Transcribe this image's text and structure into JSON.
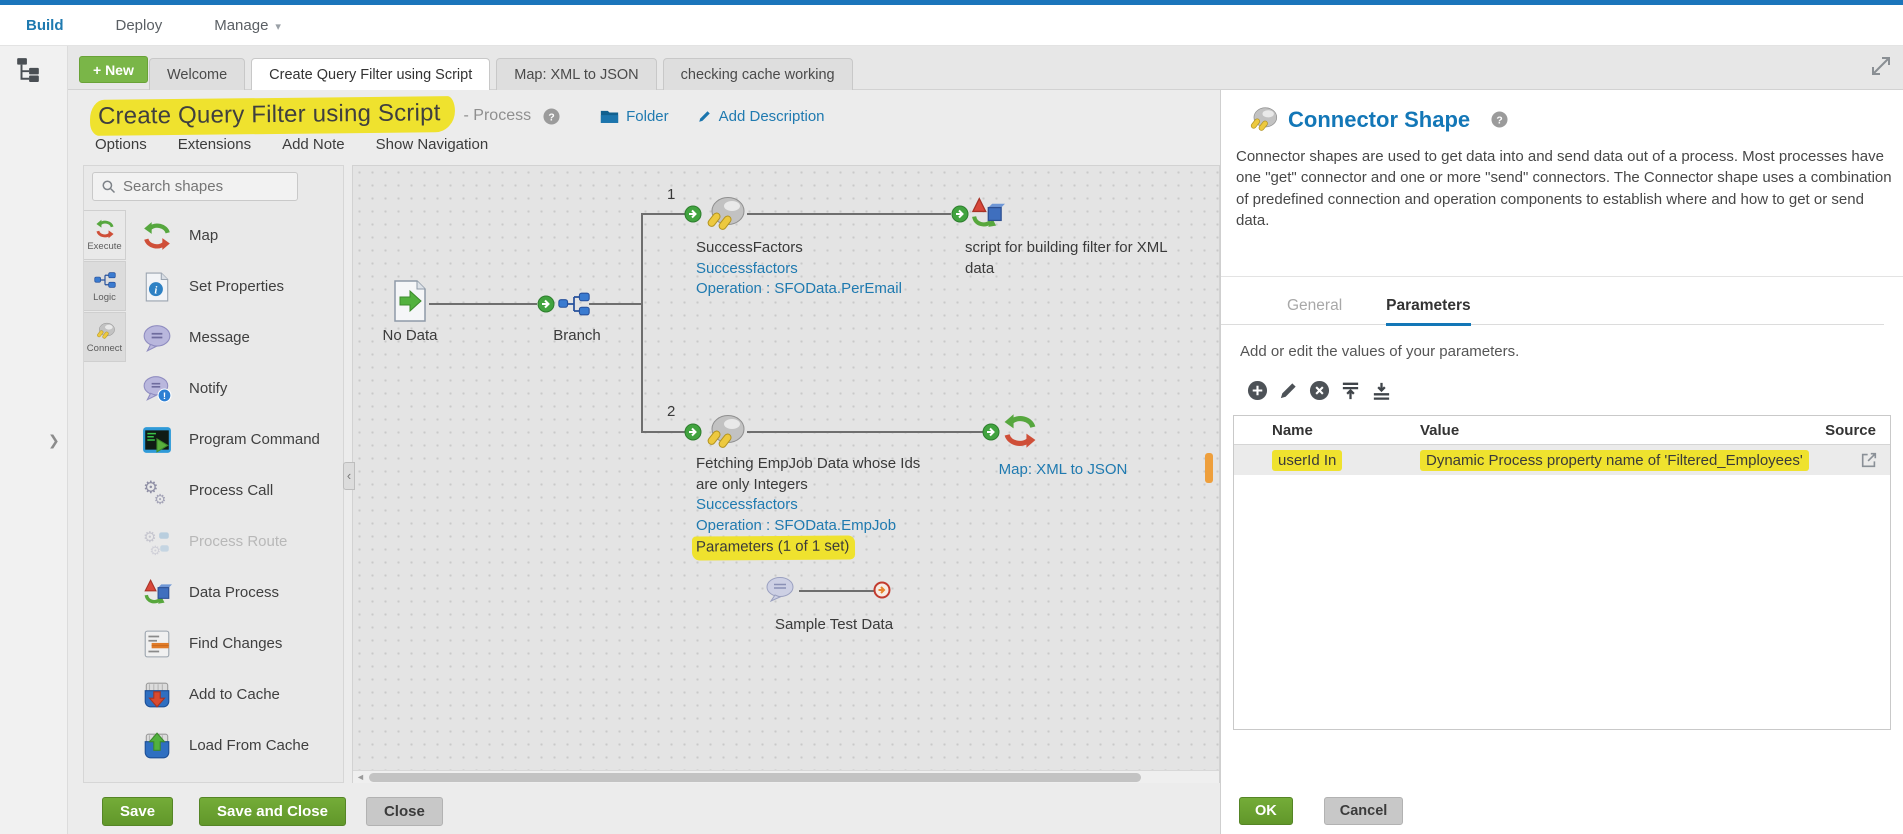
{
  "top_nav": {
    "items": [
      {
        "label": "Build",
        "active": true
      },
      {
        "label": "Deploy"
      },
      {
        "label": "Manage",
        "has_caret": true
      }
    ]
  },
  "tab_bar": {
    "new_button": "+ New",
    "tabs": [
      {
        "label": "Welcome"
      },
      {
        "label": "Create Query Filter using Script",
        "active": true
      },
      {
        "label": "Map: XML to JSON"
      },
      {
        "label": "checking cache working"
      }
    ]
  },
  "header": {
    "title": "Create Query Filter using Script",
    "type_suffix": "- Process",
    "folder_label": "Folder",
    "add_description_label": "Add Description"
  },
  "menu": {
    "items": [
      "Options",
      "Extensions",
      "Add Note",
      "Show Navigation"
    ]
  },
  "sidebar": {
    "search_placeholder": "Search shapes",
    "categories": [
      {
        "label": "Execute",
        "icon": "execute-icon",
        "active": true
      },
      {
        "label": "Logic",
        "icon": "logic-icon"
      },
      {
        "label": "Connect",
        "icon": "connect-icon"
      }
    ],
    "shapes": [
      {
        "label": "Map",
        "icon": "map-icon"
      },
      {
        "label": "Set Properties",
        "icon": "set-properties-icon"
      },
      {
        "label": "Message",
        "icon": "message-icon"
      },
      {
        "label": "Notify",
        "icon": "notify-icon"
      },
      {
        "label": "Program Command",
        "icon": "program-command-icon"
      },
      {
        "label": "Process Call",
        "icon": "process-call-icon"
      },
      {
        "label": "Process Route",
        "icon": "process-route-icon",
        "disabled": true
      },
      {
        "label": "Data Process",
        "icon": "data-process-icon"
      },
      {
        "label": "Find Changes",
        "icon": "find-changes-icon"
      },
      {
        "label": "Add to Cache",
        "icon": "add-to-cache-icon"
      },
      {
        "label": "Load From Cache",
        "icon": "load-from-cache-icon"
      }
    ]
  },
  "canvas": {
    "start_label": "No Data",
    "branch_label": "Branch",
    "branch1": {
      "number": "1",
      "connector_title": "SuccessFactors",
      "connection_link": "Successfactors",
      "operation_link": "Operation : SFOData.PerEmail",
      "next_label": "script for building filter for XML data"
    },
    "branch2": {
      "number": "2",
      "connector_title": "Fetching EmpJob Data whose Ids are only Integers",
      "connection_link": "Successfactors",
      "operation_link": "Operation : SFOData.EmpJob",
      "parameters_link": "Parameters (1 of 1 set)",
      "next_label": "Map: XML to JSON"
    },
    "note_label": "Sample Test Data"
  },
  "footer": {
    "save": "Save",
    "save_and_close": "Save and Close",
    "close": "Close"
  },
  "panel": {
    "title": "Connector Shape",
    "description": "Connector shapes are used to get data into and send data out of a process. Most processes have one \"get\" connector and one or more \"send\" connectors. The Connector shape uses a combination of predefined connection and operation components to establish where and how to get or send data.",
    "tabs": [
      {
        "label": "General"
      },
      {
        "label": "Parameters",
        "active": true
      }
    ],
    "hint": "Add or edit the values of your parameters.",
    "table": {
      "columns": [
        "Name",
        "Value",
        "Source"
      ],
      "rows": [
        {
          "name": "userId In",
          "value": "Dynamic Process property name of 'Filtered_Employees'",
          "highlight": true
        }
      ]
    },
    "ok_label": "OK",
    "cancel_label": "Cancel"
  },
  "colors": {
    "accent_blue": "#1f7ab0",
    "action_green": "#69a52c",
    "highlight_yellow": "#efe22e"
  }
}
